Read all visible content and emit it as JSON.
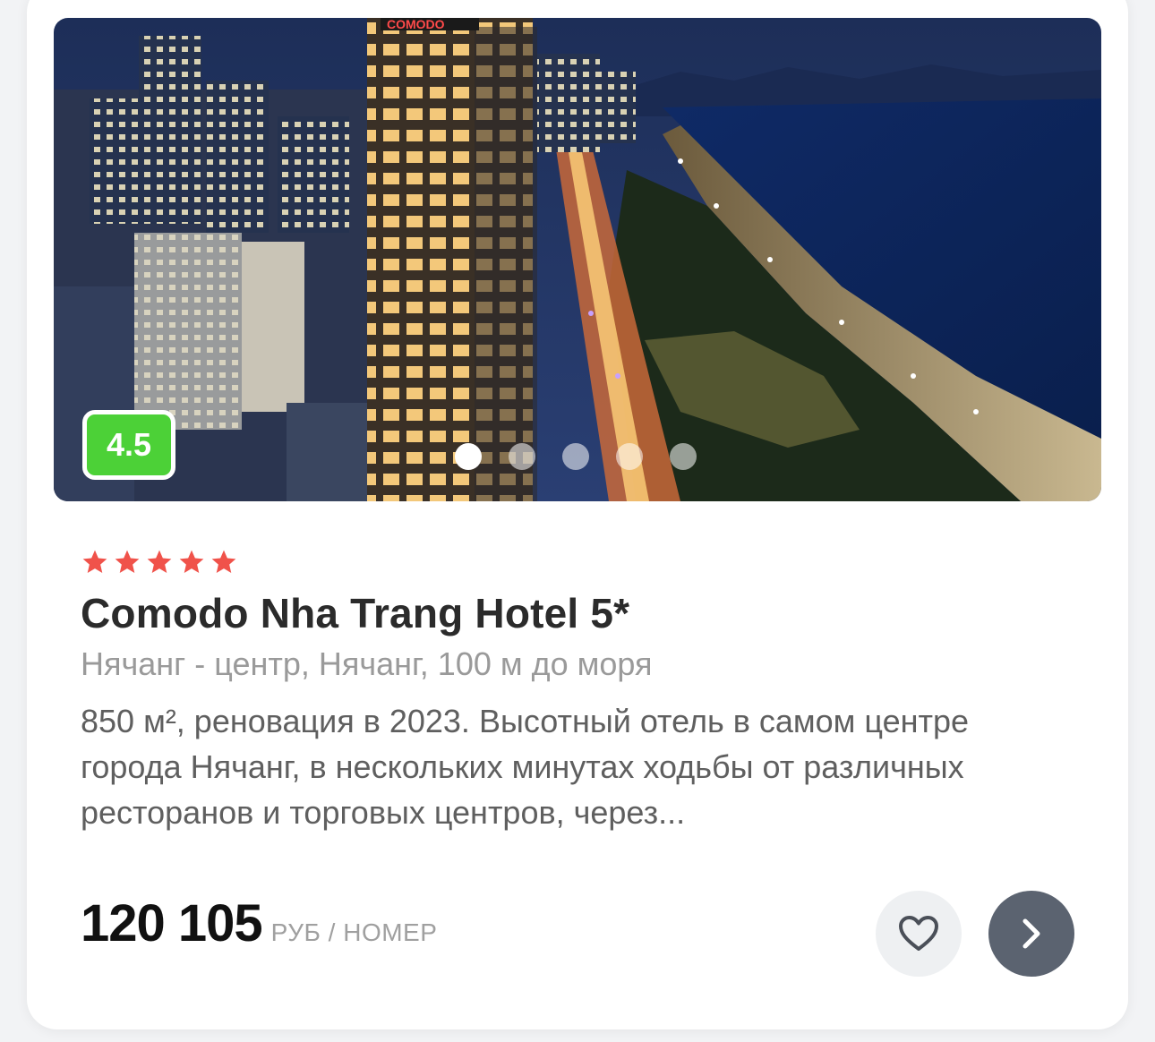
{
  "hotel": {
    "rating": "4.5",
    "stars": 5,
    "star_color": "#f0524a",
    "name": "Comodo Nha Trang Hotel 5*",
    "location": "Нячанг - центр, Нячанг, 100 м до моря",
    "description": "850 м², реновация в 2023. Высотный отель в самом центре города Нячанг, в нескольких минутах ходьбы от различных ресторанов и торговых центров, через...",
    "price": "120 105",
    "price_unit": "РУБ / НОМЕР",
    "photo_sign": "COMODO"
  },
  "gallery": {
    "dot_count": 5,
    "active_index": 0
  },
  "actions": {
    "favorite_icon": "heart-icon",
    "next_icon": "chevron-right-icon"
  },
  "colors": {
    "rating_badge": "#4cd137",
    "next_button": "#5b6370",
    "fav_button": "#eef0f2"
  }
}
